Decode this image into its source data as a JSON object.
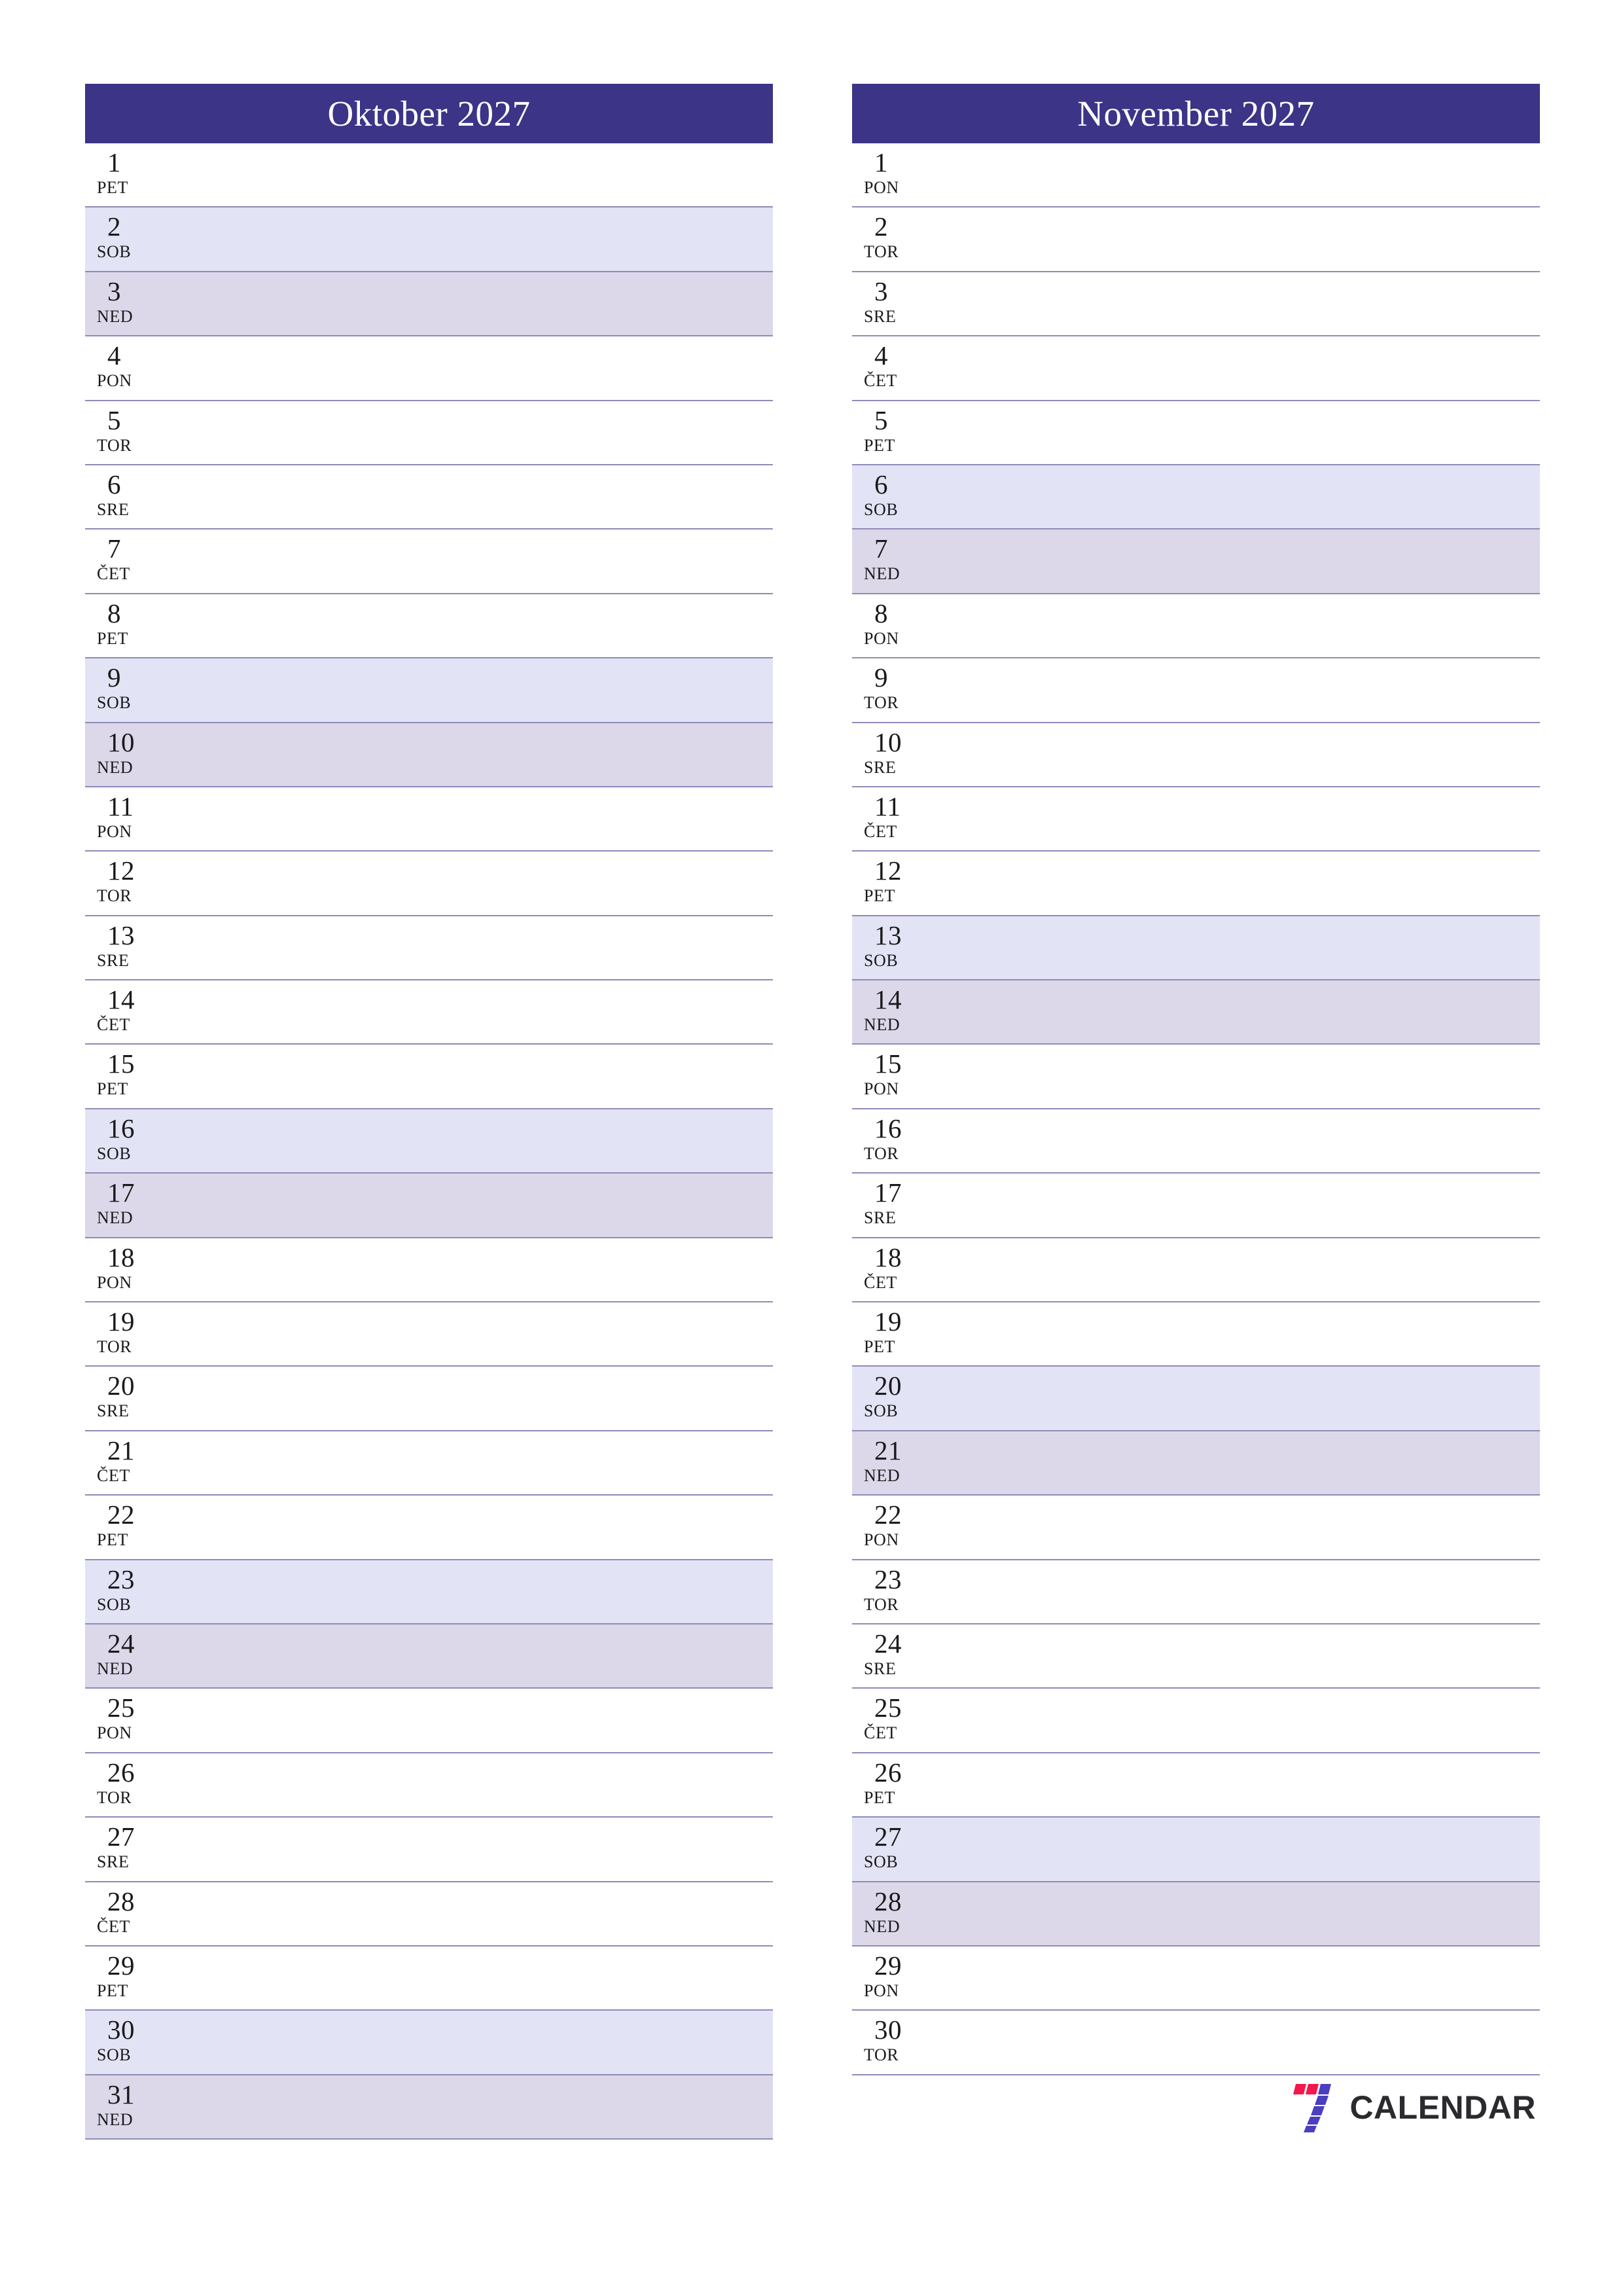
{
  "document": {
    "type": "monthly-planner",
    "language": "sl",
    "orientation": "portrait"
  },
  "theme": {
    "header_bg": "#3b3487",
    "header_text": "#ffffff",
    "row_border": "#8e8bb8",
    "saturday_bg": "#e3e3f6",
    "sunday_bg": "#dcd8ea",
    "weekday_bg": "#ffffff",
    "text": "#1a1a1a",
    "logo_red": "#f4174c",
    "logo_purple": "#4b3ec0",
    "logo_word": "#2b2b2f"
  },
  "months": [
    {
      "title": "Oktober 2027",
      "days": [
        {
          "num": "1",
          "abbr": "PET",
          "type": "weekday"
        },
        {
          "num": "2",
          "abbr": "SOB",
          "type": "sat"
        },
        {
          "num": "3",
          "abbr": "NED",
          "type": "sun"
        },
        {
          "num": "4",
          "abbr": "PON",
          "type": "weekday"
        },
        {
          "num": "5",
          "abbr": "TOR",
          "type": "weekday"
        },
        {
          "num": "6",
          "abbr": "SRE",
          "type": "weekday"
        },
        {
          "num": "7",
          "abbr": "ČET",
          "type": "weekday"
        },
        {
          "num": "8",
          "abbr": "PET",
          "type": "weekday"
        },
        {
          "num": "9",
          "abbr": "SOB",
          "type": "sat"
        },
        {
          "num": "10",
          "abbr": "NED",
          "type": "sun"
        },
        {
          "num": "11",
          "abbr": "PON",
          "type": "weekday"
        },
        {
          "num": "12",
          "abbr": "TOR",
          "type": "weekday"
        },
        {
          "num": "13",
          "abbr": "SRE",
          "type": "weekday"
        },
        {
          "num": "14",
          "abbr": "ČET",
          "type": "weekday"
        },
        {
          "num": "15",
          "abbr": "PET",
          "type": "weekday"
        },
        {
          "num": "16",
          "abbr": "SOB",
          "type": "sat"
        },
        {
          "num": "17",
          "abbr": "NED",
          "type": "sun"
        },
        {
          "num": "18",
          "abbr": "PON",
          "type": "weekday"
        },
        {
          "num": "19",
          "abbr": "TOR",
          "type": "weekday"
        },
        {
          "num": "20",
          "abbr": "SRE",
          "type": "weekday"
        },
        {
          "num": "21",
          "abbr": "ČET",
          "type": "weekday"
        },
        {
          "num": "22",
          "abbr": "PET",
          "type": "weekday"
        },
        {
          "num": "23",
          "abbr": "SOB",
          "type": "sat"
        },
        {
          "num": "24",
          "abbr": "NED",
          "type": "sun"
        },
        {
          "num": "25",
          "abbr": "PON",
          "type": "weekday"
        },
        {
          "num": "26",
          "abbr": "TOR",
          "type": "weekday"
        },
        {
          "num": "27",
          "abbr": "SRE",
          "type": "weekday"
        },
        {
          "num": "28",
          "abbr": "ČET",
          "type": "weekday"
        },
        {
          "num": "29",
          "abbr": "PET",
          "type": "weekday"
        },
        {
          "num": "30",
          "abbr": "SOB",
          "type": "sat"
        },
        {
          "num": "31",
          "abbr": "NED",
          "type": "sun"
        }
      ]
    },
    {
      "title": "November 2027",
      "days": [
        {
          "num": "1",
          "abbr": "PON",
          "type": "weekday"
        },
        {
          "num": "2",
          "abbr": "TOR",
          "type": "weekday"
        },
        {
          "num": "3",
          "abbr": "SRE",
          "type": "weekday"
        },
        {
          "num": "4",
          "abbr": "ČET",
          "type": "weekday"
        },
        {
          "num": "5",
          "abbr": "PET",
          "type": "weekday"
        },
        {
          "num": "6",
          "abbr": "SOB",
          "type": "sat"
        },
        {
          "num": "7",
          "abbr": "NED",
          "type": "sun"
        },
        {
          "num": "8",
          "abbr": "PON",
          "type": "weekday"
        },
        {
          "num": "9",
          "abbr": "TOR",
          "type": "weekday"
        },
        {
          "num": "10",
          "abbr": "SRE",
          "type": "weekday"
        },
        {
          "num": "11",
          "abbr": "ČET",
          "type": "weekday"
        },
        {
          "num": "12",
          "abbr": "PET",
          "type": "weekday"
        },
        {
          "num": "13",
          "abbr": "SOB",
          "type": "sat"
        },
        {
          "num": "14",
          "abbr": "NED",
          "type": "sun"
        },
        {
          "num": "15",
          "abbr": "PON",
          "type": "weekday"
        },
        {
          "num": "16",
          "abbr": "TOR",
          "type": "weekday"
        },
        {
          "num": "17",
          "abbr": "SRE",
          "type": "weekday"
        },
        {
          "num": "18",
          "abbr": "ČET",
          "type": "weekday"
        },
        {
          "num": "19",
          "abbr": "PET",
          "type": "weekday"
        },
        {
          "num": "20",
          "abbr": "SOB",
          "type": "sat"
        },
        {
          "num": "21",
          "abbr": "NED",
          "type": "sun"
        },
        {
          "num": "22",
          "abbr": "PON",
          "type": "weekday"
        },
        {
          "num": "23",
          "abbr": "TOR",
          "type": "weekday"
        },
        {
          "num": "24",
          "abbr": "SRE",
          "type": "weekday"
        },
        {
          "num": "25",
          "abbr": "ČET",
          "type": "weekday"
        },
        {
          "num": "26",
          "abbr": "PET",
          "type": "weekday"
        },
        {
          "num": "27",
          "abbr": "SOB",
          "type": "sat"
        },
        {
          "num": "28",
          "abbr": "NED",
          "type": "sun"
        },
        {
          "num": "29",
          "abbr": "PON",
          "type": "weekday"
        },
        {
          "num": "30",
          "abbr": "TOR",
          "type": "weekday"
        }
      ]
    }
  ],
  "branding": {
    "wordmark": "CALENDAR",
    "mark_name": "seven-logo-icon"
  }
}
